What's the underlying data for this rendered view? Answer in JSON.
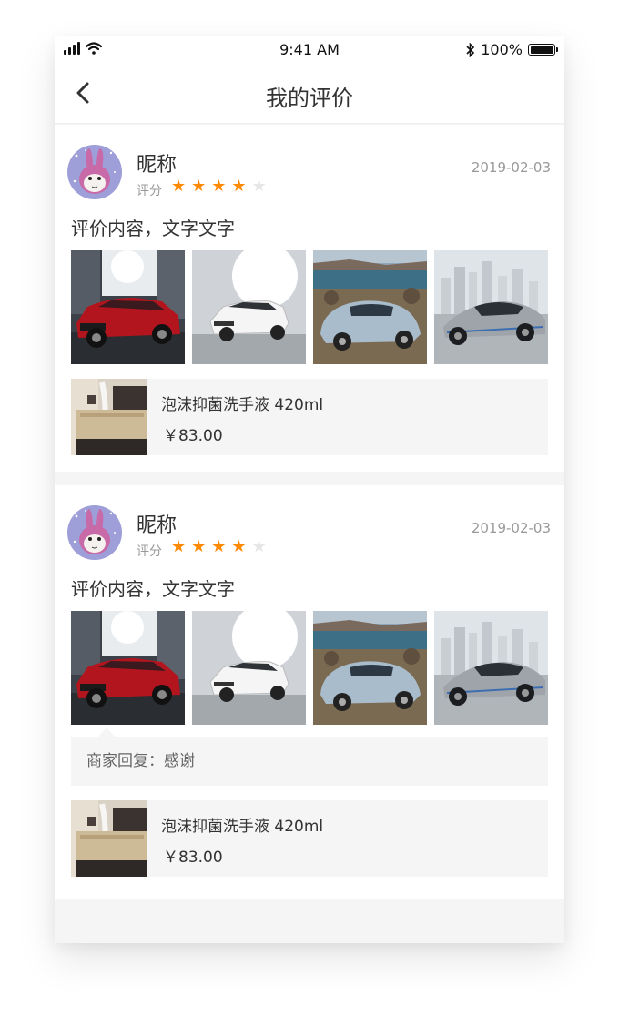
{
  "status_bar": {
    "time": "9:41 AM",
    "battery": "100%"
  },
  "nav": {
    "title": "我的评价",
    "back_icon": "chevron-left-icon"
  },
  "reviews": [
    {
      "nickname": "昵称",
      "rating_label": "评分",
      "rating": 4,
      "rating_max": 5,
      "date": "2019-02-03",
      "content": "评价内容，文字文字",
      "photos": [
        "red-suv-photo",
        "white-sedan-photo",
        "blue-beetle-photo",
        "silver-sportscar-photo"
      ],
      "product": {
        "name": "泡沫抑菌洗手液 420ml",
        "price": "￥83.00"
      }
    },
    {
      "nickname": "昵称",
      "rating_label": "评分",
      "rating": 4,
      "rating_max": 5,
      "date": "2019-02-03",
      "content": "评价内容，文字文字",
      "photos": [
        "red-suv-photo",
        "white-sedan-photo",
        "blue-beetle-photo",
        "silver-sportscar-photo"
      ],
      "merchant_reply": "商家回复：感谢",
      "product": {
        "name": "泡沫抑菌洗手液 420ml",
        "price": "￥83.00"
      }
    }
  ],
  "colors": {
    "accent_star": "#ff8a00",
    "star_off": "#e6e6e6",
    "page_bg": "#f5f5f5"
  }
}
